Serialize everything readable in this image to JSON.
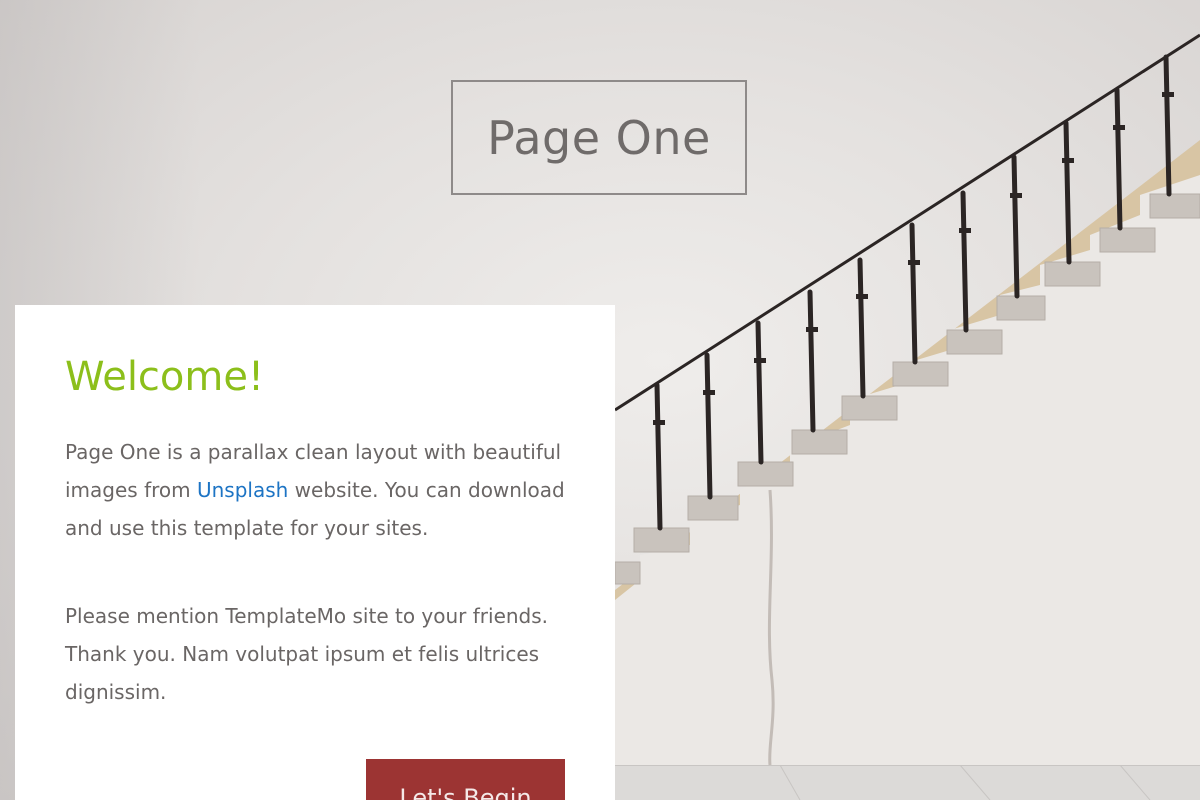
{
  "header": {
    "site_title": "Page One"
  },
  "welcome": {
    "heading": "Welcome!",
    "paragraph1_before_link": "Page One is a parallax clean layout with beautiful images from ",
    "paragraph1_link": "Unsplash",
    "paragraph1_after_link": " website. You can download and use this template for your sites.",
    "paragraph2": "Please mention TemplateMo site to your friends. Thank you. Nam volutpat ipsum et felis ultrices dignissim.",
    "button_label": "Let's Begin"
  },
  "colors": {
    "heading_green": "#8cbf1b",
    "link_blue": "#1d74c4",
    "button_red": "#9c3433",
    "body_text": "#6a6665"
  }
}
